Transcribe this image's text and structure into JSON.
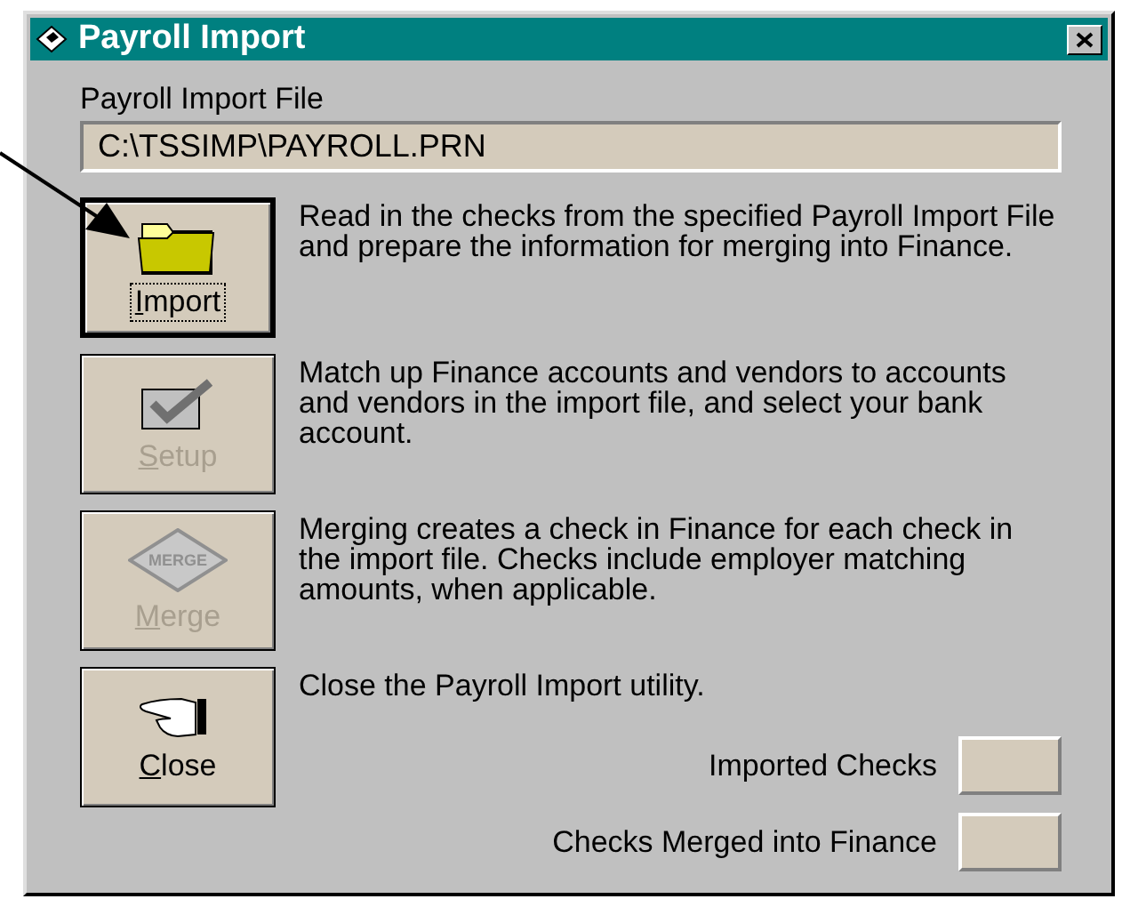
{
  "window": {
    "title": "Payroll Import"
  },
  "file": {
    "label": "Payroll Import File",
    "value": "C:\\TSSIMP\\PAYROLL.PRN"
  },
  "actions": [
    {
      "kind": "import",
      "label": "Import",
      "description": "Read in the checks from the specified Payroll Import File and prepare the information for merging into Finance.",
      "disabled": false,
      "focused": true
    },
    {
      "kind": "setup",
      "label": "Setup",
      "description": "Match up Finance accounts and vendors to accounts and vendors in the import file, and select your bank account.",
      "disabled": true,
      "focused": false
    },
    {
      "kind": "merge",
      "label": "Merge",
      "icon_text": "MERGE",
      "description": "Merging creates a check in Finance for each check in the import file.  Checks include employer matching amounts, when applicable.",
      "disabled": true,
      "focused": false
    },
    {
      "kind": "close",
      "label": "Close",
      "description": "Close the Payroll Import utility.",
      "disabled": false,
      "focused": false
    }
  ],
  "counters": [
    {
      "label": "Imported Checks"
    },
    {
      "label": "Checks Merged into Finance"
    }
  ]
}
